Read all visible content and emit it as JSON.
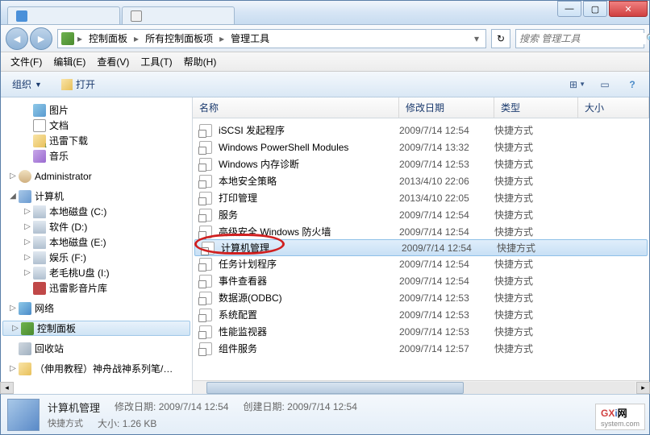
{
  "window": {
    "tabs": [
      {
        "label": ""
      },
      {
        "label": ""
      }
    ],
    "controls": {
      "min": "—",
      "max": "▢",
      "close": "✕"
    }
  },
  "breadcrumb": {
    "items": [
      "控制面板",
      "所有控制面板项",
      "管理工具"
    ],
    "separator": "▸",
    "prefix_sep": "▸"
  },
  "refresh_icon": "↻",
  "search": {
    "placeholder": "搜索 管理工具",
    "icon": "🔍"
  },
  "menubar": [
    {
      "label": "文件(F)"
    },
    {
      "label": "编辑(E)"
    },
    {
      "label": "查看(V)"
    },
    {
      "label": "工具(T)"
    },
    {
      "label": "帮助(H)"
    }
  ],
  "toolbar": {
    "organize": "组织",
    "open": "打开",
    "dropdown": "▼",
    "view_icon": "⊞",
    "help_icon": "?"
  },
  "tree": [
    {
      "indent": 1,
      "expander": "",
      "icon": "ic-pics",
      "label": "图片"
    },
    {
      "indent": 1,
      "expander": "",
      "icon": "ic-docs",
      "label": "文档"
    },
    {
      "indent": 1,
      "expander": "",
      "icon": "ic-dl",
      "label": "迅雷下载"
    },
    {
      "indent": 1,
      "expander": "",
      "icon": "ic-music",
      "label": "音乐"
    },
    {
      "indent": 0,
      "expander": "▷",
      "icon": "ic-user",
      "label": "Administrator"
    },
    {
      "indent": 0,
      "expander": "◢",
      "icon": "ic-computer",
      "label": "计算机"
    },
    {
      "indent": 1,
      "expander": "▷",
      "icon": "ic-drive",
      "label": "本地磁盘 (C:)"
    },
    {
      "indent": 1,
      "expander": "▷",
      "icon": "ic-drive",
      "label": "软件 (D:)"
    },
    {
      "indent": 1,
      "expander": "▷",
      "icon": "ic-drive",
      "label": "本地磁盘 (E:)"
    },
    {
      "indent": 1,
      "expander": "▷",
      "icon": "ic-drive",
      "label": "娱乐 (F:)"
    },
    {
      "indent": 1,
      "expander": "▷",
      "icon": "ic-usb",
      "label": "老毛桃U盘 (I:)"
    },
    {
      "indent": 1,
      "expander": "",
      "icon": "ic-media",
      "label": "迅雷影音片库"
    },
    {
      "indent": 0,
      "expander": "▷",
      "icon": "ic-network",
      "label": "网络"
    },
    {
      "indent": 0,
      "expander": "▷",
      "icon": "ic-cpanel",
      "label": "控制面板",
      "selected": true
    },
    {
      "indent": 0,
      "expander": "",
      "icon": "ic-recycle",
      "label": "回收站"
    },
    {
      "indent": 0,
      "expander": "▷",
      "icon": "ic-folder",
      "label": "（伸用教程）神舟战神系列笔/…"
    }
  ],
  "columns": {
    "name": "名称",
    "date": "修改日期",
    "type": "类型",
    "size": "大小"
  },
  "files": [
    {
      "name": "iSCSI 发起程序",
      "date": "2009/7/14 12:54",
      "type": "快捷方式"
    },
    {
      "name": "Windows PowerShell Modules",
      "date": "2009/7/14 13:32",
      "type": "快捷方式"
    },
    {
      "name": "Windows 内存诊断",
      "date": "2009/7/14 12:53",
      "type": "快捷方式"
    },
    {
      "name": "本地安全策略",
      "date": "2013/4/10 22:06",
      "type": "快捷方式"
    },
    {
      "name": "打印管理",
      "date": "2013/4/10 22:05",
      "type": "快捷方式"
    },
    {
      "name": "服务",
      "date": "2009/7/14 12:54",
      "type": "快捷方式"
    },
    {
      "name": "高级安全 Windows 防火墙",
      "date": "2009/7/14 12:54",
      "type": "快捷方式"
    },
    {
      "name": "计算机管理",
      "date": "2009/7/14 12:54",
      "type": "快捷方式",
      "selected": true,
      "highlight": true
    },
    {
      "name": "任务计划程序",
      "date": "2009/7/14 12:54",
      "type": "快捷方式"
    },
    {
      "name": "事件查看器",
      "date": "2009/7/14 12:54",
      "type": "快捷方式"
    },
    {
      "name": "数据源(ODBC)",
      "date": "2009/7/14 12:53",
      "type": "快捷方式"
    },
    {
      "name": "系统配置",
      "date": "2009/7/14 12:53",
      "type": "快捷方式"
    },
    {
      "name": "性能监视器",
      "date": "2009/7/14 12:53",
      "type": "快捷方式"
    },
    {
      "name": "组件服务",
      "date": "2009/7/14 12:57",
      "type": "快捷方式"
    }
  ],
  "status": {
    "title": "计算机管理",
    "mod_label": "修改日期:",
    "mod_value": "2009/7/14 12:54",
    "create_label": "创建日期:",
    "create_value": "2009/7/14 12:54",
    "type_label": "快捷方式",
    "size_label": "大小:",
    "size_value": "1.26 KB"
  },
  "watermark": {
    "brand1": "GX",
    "brand2": "i",
    "brand3": "网",
    "sub": "system.com"
  }
}
